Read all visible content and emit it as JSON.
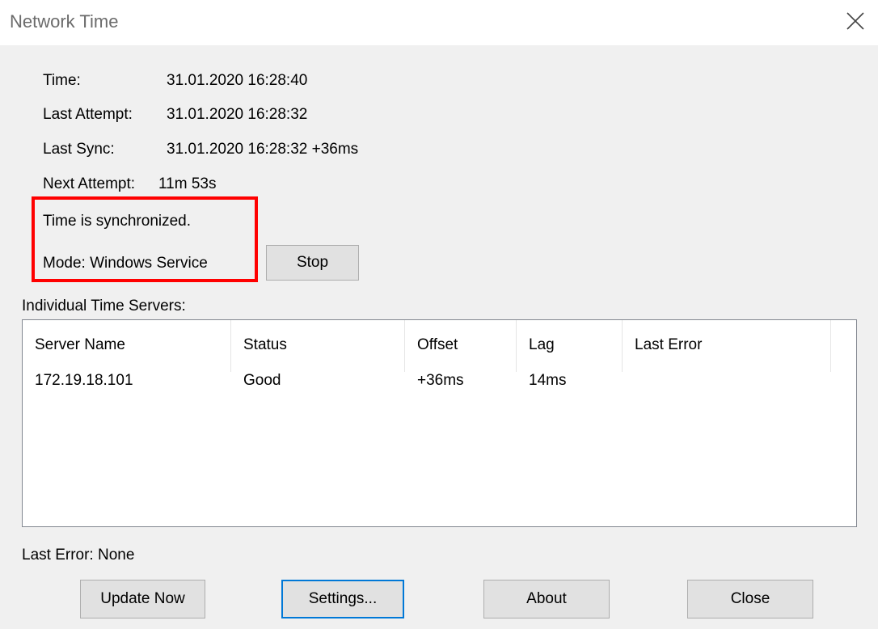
{
  "window": {
    "title": "Network Time",
    "close_icon": "close-icon"
  },
  "info": {
    "time_label": "Time:",
    "time_value": "31.01.2020 16:28:40",
    "last_attempt_label": "Last Attempt:",
    "last_attempt_value": "31.01.2020 16:28:32",
    "last_sync_label": "Last Sync:",
    "last_sync_value": "31.01.2020 16:28:32 +36ms",
    "next_attempt_label": "Next Attempt:",
    "next_attempt_value": "11m 53s",
    "sync_status": "Time is synchronized.",
    "mode": "Mode: Windows Service",
    "stop_button": "Stop"
  },
  "servers": {
    "section_label": "Individual Time Servers:",
    "columns": [
      "Server Name",
      "Status",
      "Offset",
      "Lag",
      "Last Error"
    ],
    "rows": [
      [
        "172.19.18.101",
        "Good",
        "+36ms",
        "14ms",
        ""
      ]
    ]
  },
  "footer": {
    "last_error": "Last Error:  None",
    "buttons": {
      "update_now": "Update Now",
      "settings": "Settings...",
      "about": "About",
      "close": "Close"
    }
  },
  "colors": {
    "highlight_border": "#ff0000",
    "default_button_border": "#0078d7",
    "window_background": "#f0f0f0"
  }
}
